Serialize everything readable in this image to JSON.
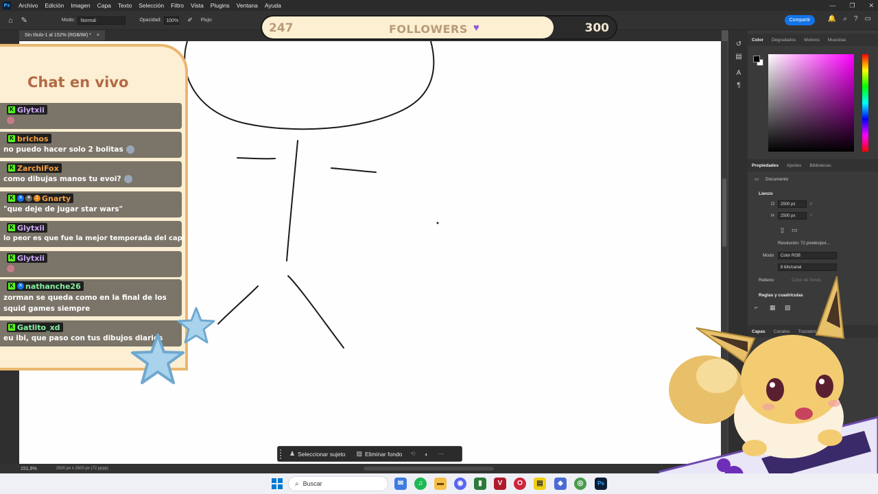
{
  "app": {
    "menu": [
      "Archivo",
      "Edición",
      "Imagen",
      "Capa",
      "Texto",
      "Selección",
      "Filtro",
      "Vista",
      "Plugins",
      "Ventana",
      "Ayuda"
    ],
    "logo": "Ps"
  },
  "options": {
    "mode_label": "Modo:",
    "mode_value": "Normal",
    "opacity_label": "Opacidad:",
    "opacity_value": "100%",
    "flow_label": "Flujo:",
    "share_label": "Compartir"
  },
  "document": {
    "tab_title": "Sin título-1 al 152% (RGB/8#) *",
    "zoom": "151,9%",
    "size_info": "2500 px x 2500 px (72 pppp)"
  },
  "followers": {
    "current": "247",
    "label": "FOLLOWERS",
    "goal": "300",
    "progress": 0.823
  },
  "chat": {
    "title": "Chat en vivo",
    "messages": [
      {
        "user": "Glytxii",
        "text": "",
        "color": "#cba6f7",
        "emote_only": true
      },
      {
        "user": "brichos",
        "text": "no puedo hacer solo 2 bolitas",
        "color": "#f59e42",
        "emote": true
      },
      {
        "user": "ZarchiFox",
        "text": "como dibujas manos tu evoi?",
        "color": "#f59e42",
        "emote": true
      },
      {
        "user": "Gnarty",
        "text": "\"que deje de jugar star wars\"",
        "color": "#f59e42",
        "badges": 3
      },
      {
        "user": "Glytxii",
        "text": "lo peor es que fue la mejor temporada del capitulo",
        "color": "#cba6f7"
      },
      {
        "user": "Glytxii",
        "text": "",
        "color": "#cba6f7",
        "emote_only": true
      },
      {
        "user": "nathanche26",
        "text": "zorman se queda como en la final de los squid games siempre",
        "color": "#84f0a0",
        "badges": 1,
        "wrap": true
      },
      {
        "user": "Gatlito_xd",
        "text": "eu ibi, que paso con tus dibujos diarios",
        "color": "#84f0a0"
      }
    ]
  },
  "panels": {
    "color_tabs": [
      "Color",
      "Degradados",
      "Motivos",
      "Muestras"
    ],
    "props_tabs": [
      "Propiedades",
      "Ajustes",
      "Bibliotecas"
    ],
    "doc_label": "Documento",
    "canvas_section": "Lienzo",
    "width_label": "O",
    "width_value": "2500 px",
    "height_label": "H",
    "height_value": "2500 px",
    "x_label": "X",
    "y_label": "Y",
    "resolution": "Resolución: 72 píxeles/pul...",
    "mode_label": "Modo",
    "mode_value": "Color RGB",
    "depth_value": "8 bits/canal",
    "fill_label": "Relleno",
    "fill_value": "Color de fondo",
    "rulers_section": "Reglas y cuadrículas",
    "layers_tabs": [
      "Capas",
      "Canales",
      "Trazados"
    ]
  },
  "ctxbar": {
    "select_subject": "Seleccionar sujeto",
    "remove_bg": "Eliminar fondo"
  },
  "taskbar": {
    "search_placeholder": "Buscar"
  }
}
